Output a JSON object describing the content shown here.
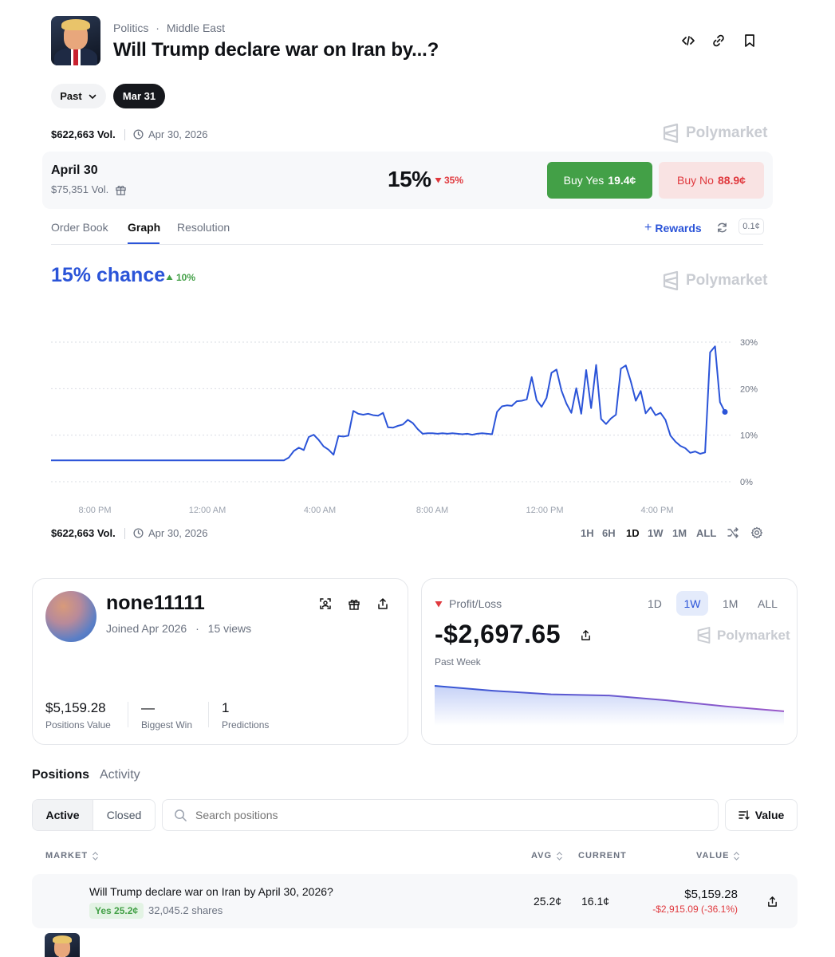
{
  "header": {
    "breadcrumb_category": "Politics",
    "breadcrumb_sep": "·",
    "breadcrumb_sub": "Middle East",
    "title": "Will Trump declare war on Iran by...?",
    "icons": [
      "embed-code-icon",
      "link-icon",
      "bookmark-icon"
    ]
  },
  "date_filters": {
    "past_label": "Past",
    "selected_label": "Mar 31"
  },
  "summary": {
    "volume": "$622,663 Vol.",
    "end_date": "Apr 30, 2026",
    "brand": "Polymarket"
  },
  "market_row": {
    "name": "April 30",
    "volume": "$75,351 Vol.",
    "probability": "15%",
    "change": "35%",
    "buy_yes_label": "Buy Yes",
    "buy_yes_price": "19.4¢",
    "buy_no_label": "Buy No",
    "buy_no_price": "88.9¢"
  },
  "tabs": {
    "items": [
      "Order Book",
      "Graph",
      "Resolution"
    ],
    "active": "Graph",
    "rewards_label": "Rewards",
    "spread_badge": "0.1¢"
  },
  "graph_header": {
    "chance": "15% chance",
    "change": "10%",
    "brand": "Polymarket"
  },
  "chart_data": {
    "type": "line",
    "x_tick_labels": [
      "8:00 PM",
      "12:00 AM",
      "4:00 AM",
      "8:00 AM",
      "12:00 PM",
      "4:00 PM"
    ],
    "y_tick_labels": [
      "30%",
      "20%",
      "10%",
      "0%"
    ],
    "ylim": [
      0,
      30
    ],
    "grid": true,
    "colors": {
      "line": "#2b54d8",
      "grid": "#d9dce3"
    },
    "series": [
      {
        "values": [
          4.6,
          4.6,
          4.6,
          4.6,
          4.6,
          4.6,
          4.6,
          4.6,
          4.6,
          4.6,
          4.6,
          4.6,
          4.6,
          4.6,
          4.6,
          4.6,
          4.6,
          4.6,
          4.6,
          4.6,
          4.6,
          4.6,
          4.6,
          4.6,
          4.6,
          4.6,
          4.6,
          4.6,
          4.6,
          4.6,
          4.6,
          4.6,
          4.6,
          4.6,
          4.6,
          4.6,
          4.6,
          4.6,
          4.6,
          4.6,
          4.6,
          4.6,
          4.6,
          4.6,
          4.6,
          4.6,
          4.6,
          4.6,
          5.2,
          6.6,
          7.3,
          6.8,
          9.6,
          10.1,
          9.0,
          7.6,
          6.9,
          5.8,
          9.8,
          9.7,
          9.9,
          15.2,
          14.6,
          14.4,
          14.6,
          14.3,
          14.2,
          14.8,
          11.7,
          11.6,
          12.0,
          12.3,
          13.3,
          12.6,
          11.3,
          10.3,
          10.4,
          10.4,
          10.3,
          10.4,
          10.3,
          10.4,
          10.3,
          10.2,
          10.3,
          10.1,
          10.3,
          10.4,
          10.3,
          10.2,
          15.0,
          16.2,
          16.4,
          16.3,
          17.3,
          17.4,
          17.7,
          22.5,
          17.5,
          16.1,
          18.0,
          23.4,
          24.1,
          19.6,
          16.8,
          14.8,
          20.1,
          14.6,
          24.0,
          15.8,
          25.1,
          13.5,
          12.4,
          13.6,
          14.4,
          24.3,
          25.0,
          21.6,
          17.4,
          19.5,
          14.7,
          16.0,
          14.3,
          14.8,
          13.3,
          9.9,
          8.6,
          7.7,
          7.2,
          6.2,
          6.5,
          6.0,
          6.3,
          27.8,
          29.1,
          17.1,
          15.0
        ]
      }
    ]
  },
  "chart_footer": {
    "volume": "$622,663 Vol.",
    "end_date": "Apr 30, 2026",
    "ranges": [
      "1H",
      "6H",
      "1D",
      "1W",
      "1M",
      "ALL"
    ],
    "active_range": "1D"
  },
  "profile": {
    "username": "none11111",
    "joined": "Joined Apr 2026",
    "sep": "·",
    "views": "15 views",
    "stats": [
      {
        "value": "$5,159.28",
        "label": "Positions Value"
      },
      {
        "value": "—",
        "label": "Biggest Win"
      },
      {
        "value": "1",
        "label": "Predictions"
      }
    ]
  },
  "pnl": {
    "label": "Profit/Loss",
    "ranges": [
      "1D",
      "1W",
      "1M",
      "ALL"
    ],
    "active_range": "1W",
    "amount": "-$2,697.65",
    "period": "Past Week",
    "brand": "Polymarket",
    "trend_values": [
      100,
      96,
      93,
      92,
      88,
      83,
      79
    ]
  },
  "positions": {
    "tabs": [
      "Positions",
      "Activity"
    ],
    "active_tab": "Positions",
    "filter_active": "Active",
    "filter_closed": "Closed",
    "search_placeholder": "Search positions",
    "sort_label": "Value",
    "columns": {
      "market": "MARKET",
      "avg": "AVG",
      "current": "CURRENT",
      "value": "VALUE"
    },
    "rows": [
      {
        "market": "Will Trump declare war on Iran by April 30, 2026?",
        "outcome": "Yes 25.2¢",
        "shares": "32,045.2 shares",
        "avg": "25.2¢",
        "current": "16.1¢",
        "value": "$5,159.28",
        "pnl": "-$2,915.09 (-36.1%)"
      }
    ]
  },
  "colors": {
    "accent_blue": "#2b54d8",
    "yes_green": "#43a047",
    "no_red": "#e0393e",
    "no_bg": "#f9e3e3",
    "rewards_blue": "#2b54d8"
  }
}
